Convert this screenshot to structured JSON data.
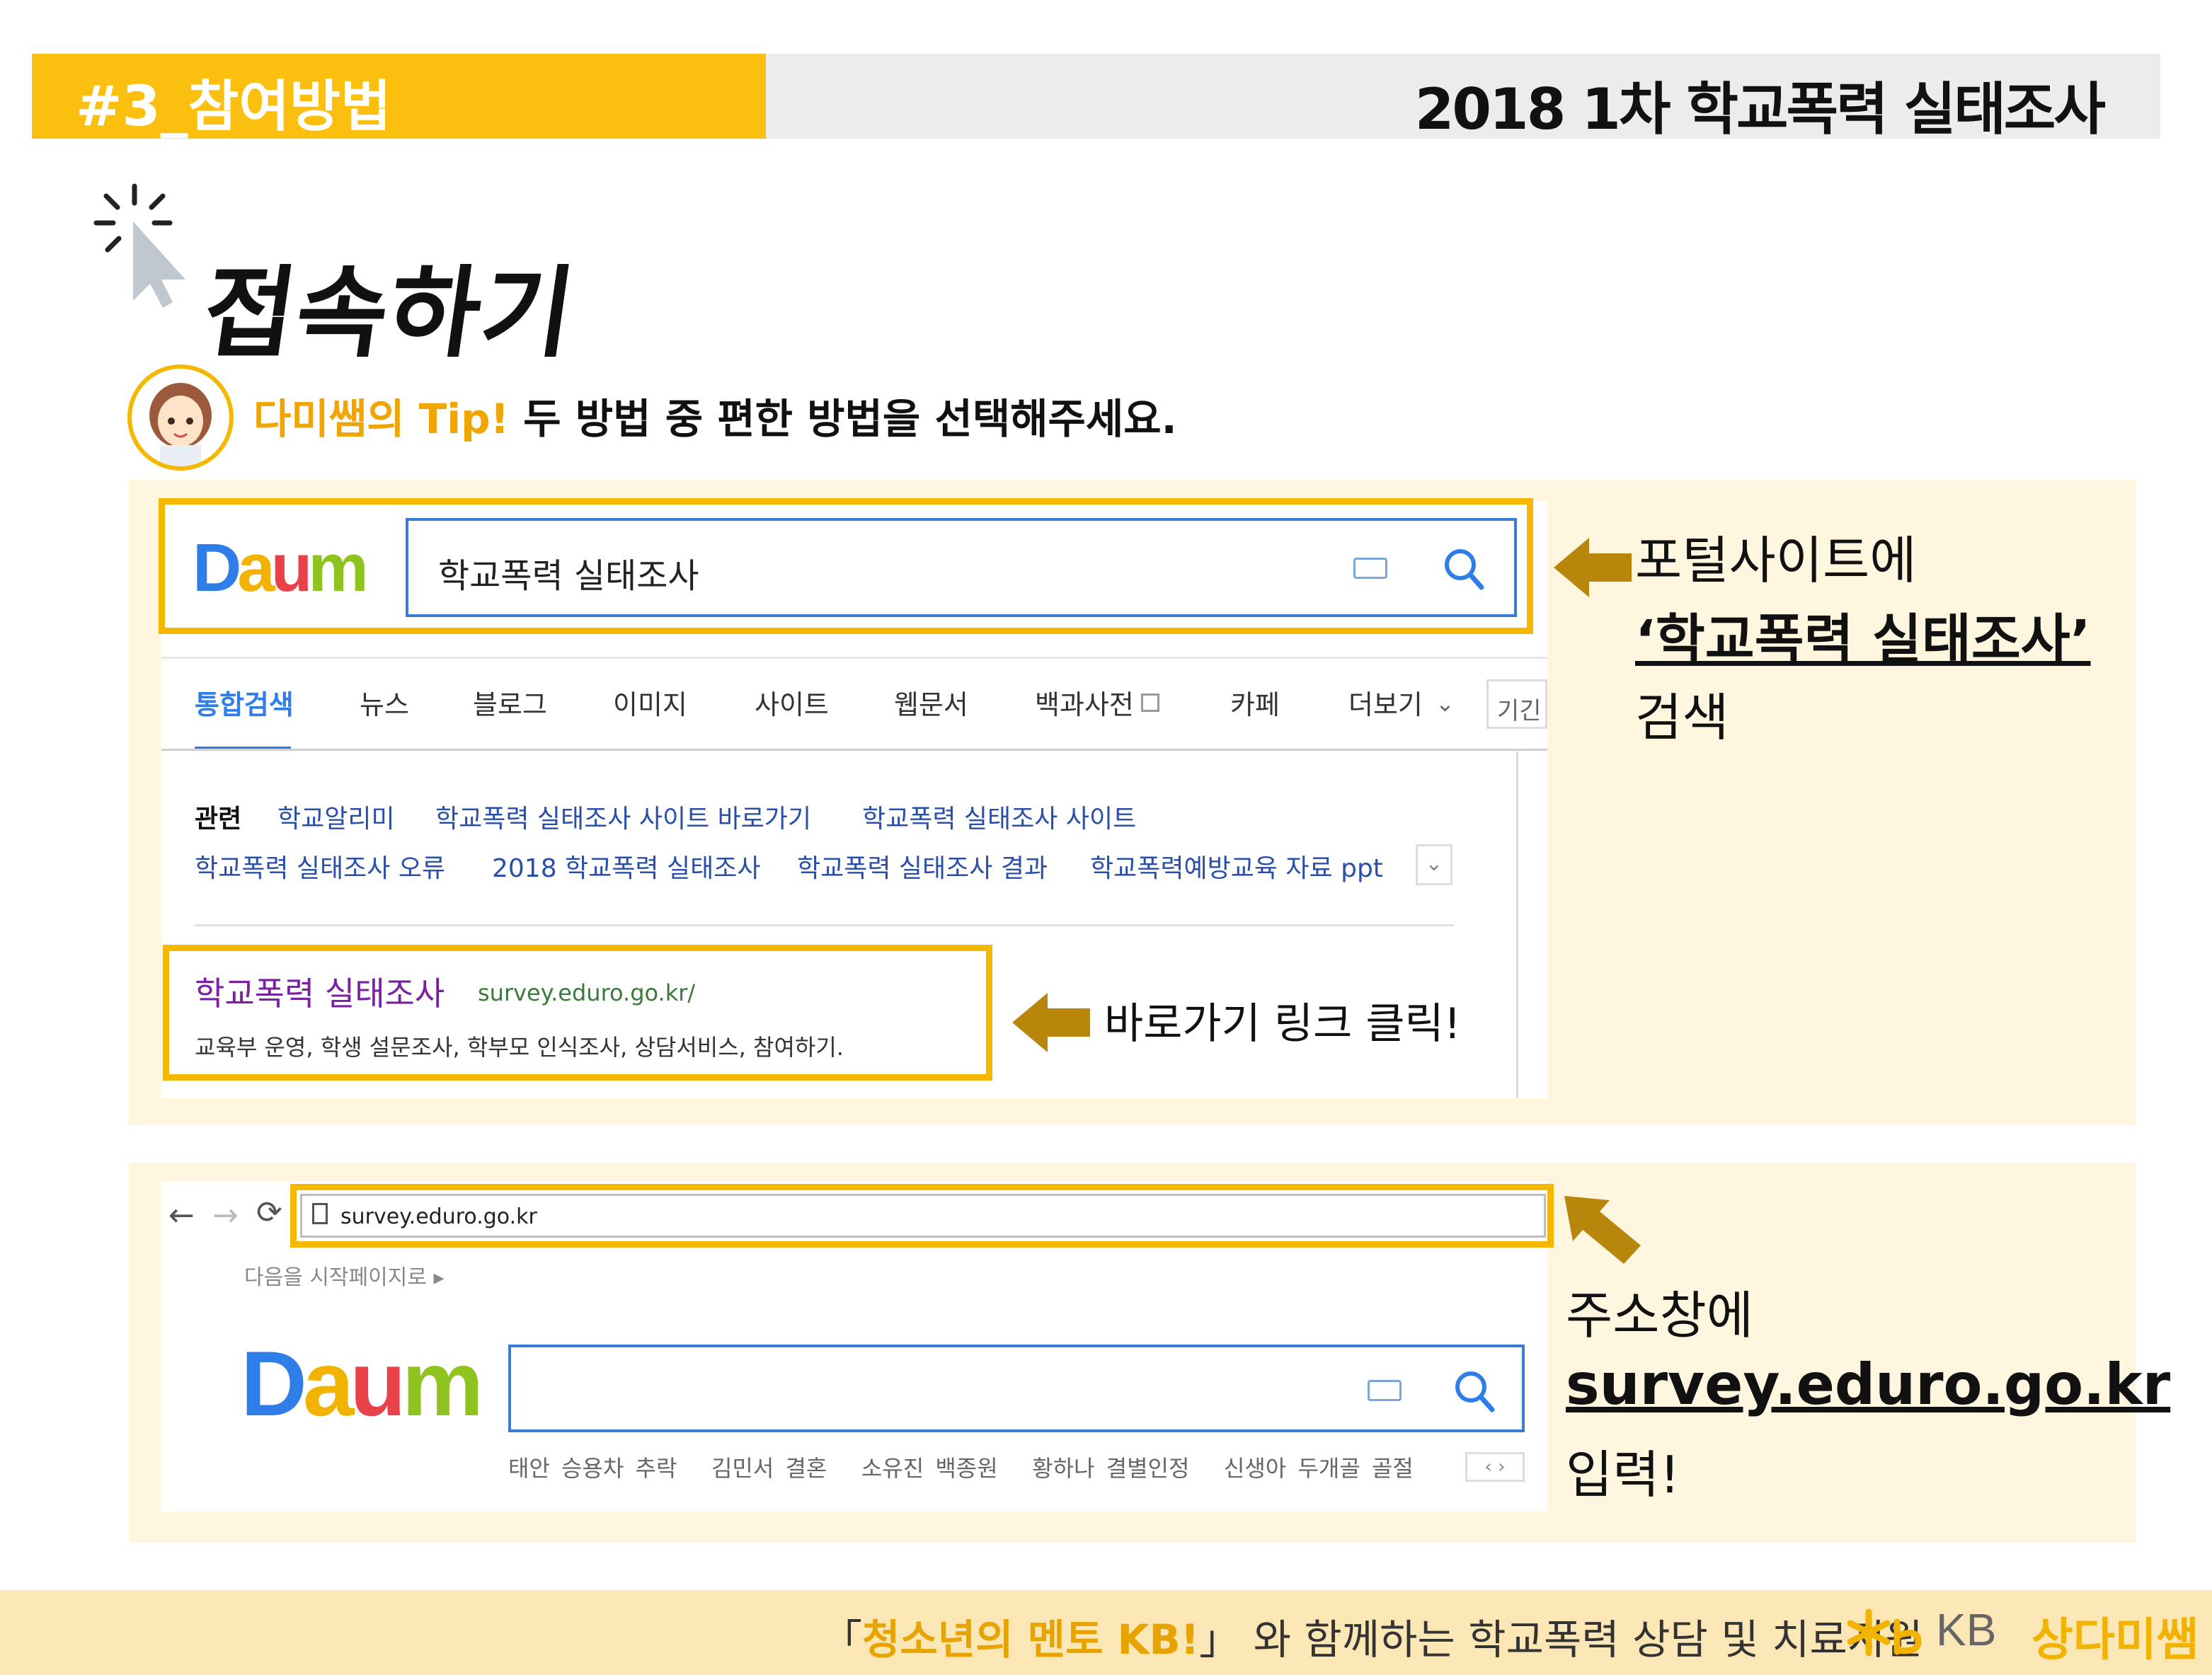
{
  "header": {
    "section": "#3_참여방법",
    "doc_title": "2018 1차 학교폭력 실태조사"
  },
  "title": "접속하기",
  "tip": {
    "label": "다미쌤의 Tip!",
    "text": "두 방법 중 편한 방법을 선택해주세요."
  },
  "method1": {
    "logo": "Daum",
    "search_value": "학교폭력 실태조사",
    "tabs": [
      "통합검색",
      "뉴스",
      "블로그",
      "이미지",
      "사이트",
      "웹문서",
      "백과사전",
      "카페",
      "더보기"
    ],
    "tabs_extra": "기긴",
    "related_label": "관련",
    "related_row1": [
      "학교알리미",
      "학교폭력 실태조사 사이트 바로가기",
      "학교폭력 실태조사 사이트"
    ],
    "related_row2": [
      "학교폭력 실태조사 오류",
      "2018 학교폭력 실태조사",
      "학교폭력 실태조사 결과",
      "학교폭력예방교육 자료 ppt"
    ],
    "result_title": "학교폭력 실태조사",
    "result_url": "survey.eduro.go.kr/",
    "result_desc": "교육부 운영, 학생 설문조사, 학부모 인식조사, 상담서비스, 참여하기.",
    "annot_link": "바로가기 링크 클릭!",
    "annot_line1": "포털사이트에",
    "annot_line2": "‘학교폭력 실태조사’",
    "annot_line3": "검색"
  },
  "method2": {
    "address_value": "survey.eduro.go.kr",
    "homepage_text": "다음을 시작페이지로 ▸",
    "logo": "Daum",
    "trending": [
      "태안 승용차 추락",
      "김민서 결혼",
      "소유진 백종원",
      "황하나 결별인정",
      "신생아 두개골 골절"
    ],
    "annot_line1": "주소창에",
    "annot_line2": "survey.eduro.go.kr",
    "annot_line3": "입력!"
  },
  "footer": {
    "bracket_open": "「",
    "mentor": "청소년의 멘토 KB!",
    "bracket_close": "」",
    "text": "와 함께하는 학교폭력 상담 및 치료지원",
    "brand_kb": "KB",
    "brand_name": "상다미쌤"
  },
  "colors": {
    "accent_yellow": "#fbbf0f",
    "arrow_gold": "#b8860b",
    "link_purple": "#7b1fa2",
    "daum_blue": "#2f7ee8"
  }
}
